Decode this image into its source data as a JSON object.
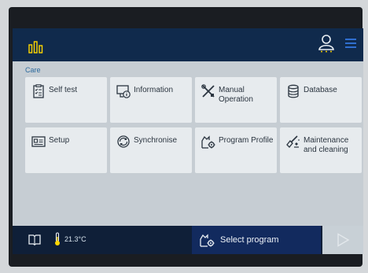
{
  "breadcrumb": "Care",
  "tiles": [
    {
      "label": "Self test",
      "icon": "clipboard-check-icon"
    },
    {
      "label": "Information",
      "icon": "info-screen-icon"
    },
    {
      "label": "Manual Operation",
      "icon": "tools-icon"
    },
    {
      "label": "Database",
      "icon": "database-icon"
    },
    {
      "label": "Setup",
      "icon": "setup-icon"
    },
    {
      "label": "Synchronise",
      "icon": "synchronise-icon"
    },
    {
      "label": "Program Profile",
      "icon": "program-profile-icon"
    },
    {
      "label": "Maintenance and cleaning",
      "icon": "maintenance-icon"
    }
  ],
  "status": {
    "temperature": "21.3°C"
  },
  "select_program": "Select program",
  "colors": {
    "topbar": "#102a4c",
    "bottombar": "#0f1f38",
    "accent": "#ffd700",
    "primary_button": "#122a5e",
    "tile": "#e7ebee"
  }
}
